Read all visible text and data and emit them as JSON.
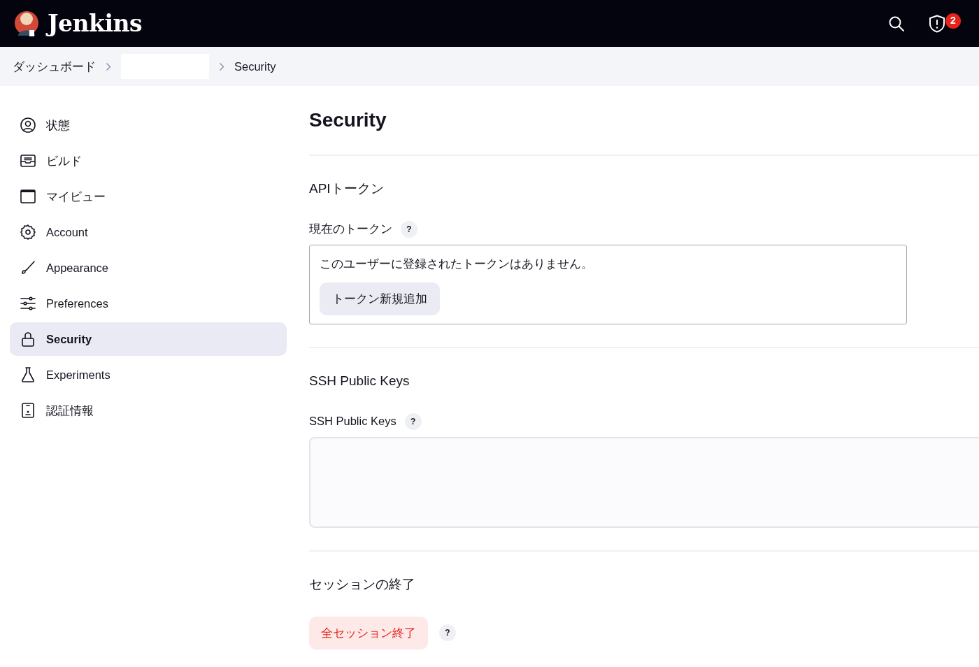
{
  "header": {
    "brand": "Jenkins",
    "alerts_count": "2"
  },
  "breadcrumb": [
    {
      "label": "ダッシュボード",
      "redacted": false
    },
    {
      "redacted": true
    },
    {
      "label": "Security",
      "redacted": false
    }
  ],
  "sidebar": {
    "items": [
      {
        "label": "状態",
        "selected": false
      },
      {
        "label": "ビルド",
        "selected": false
      },
      {
        "label": "マイビュー",
        "selected": false
      },
      {
        "label": "Account",
        "selected": false
      },
      {
        "label": "Appearance",
        "selected": false
      },
      {
        "label": "Preferences",
        "selected": false
      },
      {
        "label": "Security",
        "selected": true
      },
      {
        "label": "Experiments",
        "selected": false
      },
      {
        "label": "認証情報",
        "selected": false
      }
    ]
  },
  "page_title": "Security",
  "sections": [
    {
      "kind": "token",
      "heading": "APIトークン",
      "field_label": "現在のトークン",
      "help": "?",
      "message": "このユーザーに登録されたトークンはありません。",
      "button": "トークン新規追加"
    },
    {
      "kind": "textarea",
      "heading": "SSH Public Keys",
      "field_label": "SSH Public Keys",
      "help": "?"
    },
    {
      "kind": "danger",
      "heading": "セッションの終了",
      "button": "全セッション終了",
      "help": "?"
    }
  ]
}
